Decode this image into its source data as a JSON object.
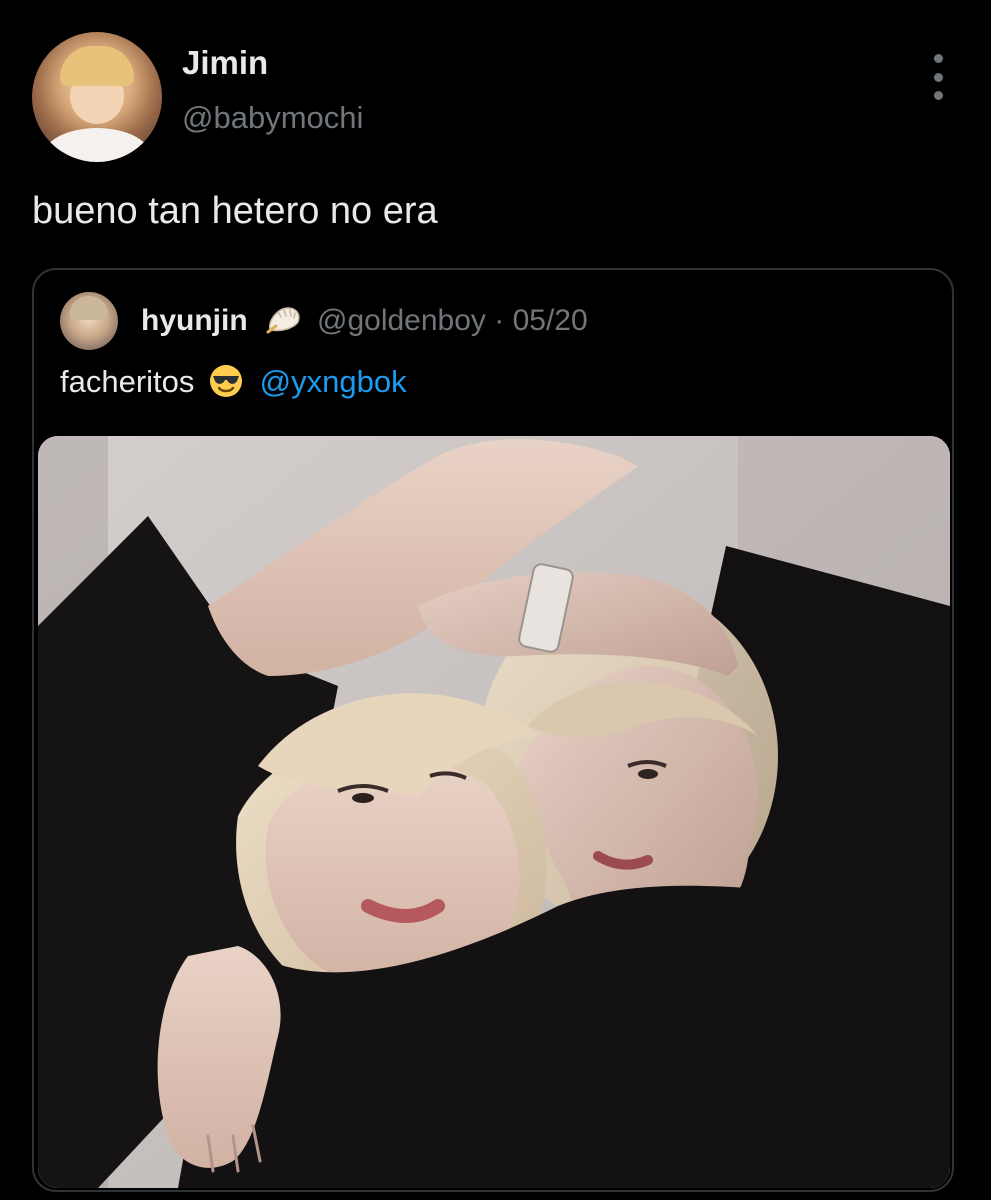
{
  "tweet": {
    "display_name": "Jimin",
    "handle": "@babymochi",
    "text": "bueno tan hetero no era",
    "avatar_icon": "user-avatar",
    "more_icon": "more-vertical-icon"
  },
  "quoted_tweet": {
    "display_name": "hyunjin",
    "badge_icon": "dumpling-emoji",
    "handle_and_date": "@goldenboy · 05/20",
    "text": "facheritos",
    "text_emoji_icon": "smiling-face-with-sunglasses-emoji",
    "mention": "@yxngbok",
    "media_icon": "attached-photo"
  },
  "colors": {
    "background": "#000000",
    "primary_text": "#e7e9ea",
    "secondary_text": "#71767b",
    "link": "#1d9bf0",
    "border": "#2f3336"
  }
}
